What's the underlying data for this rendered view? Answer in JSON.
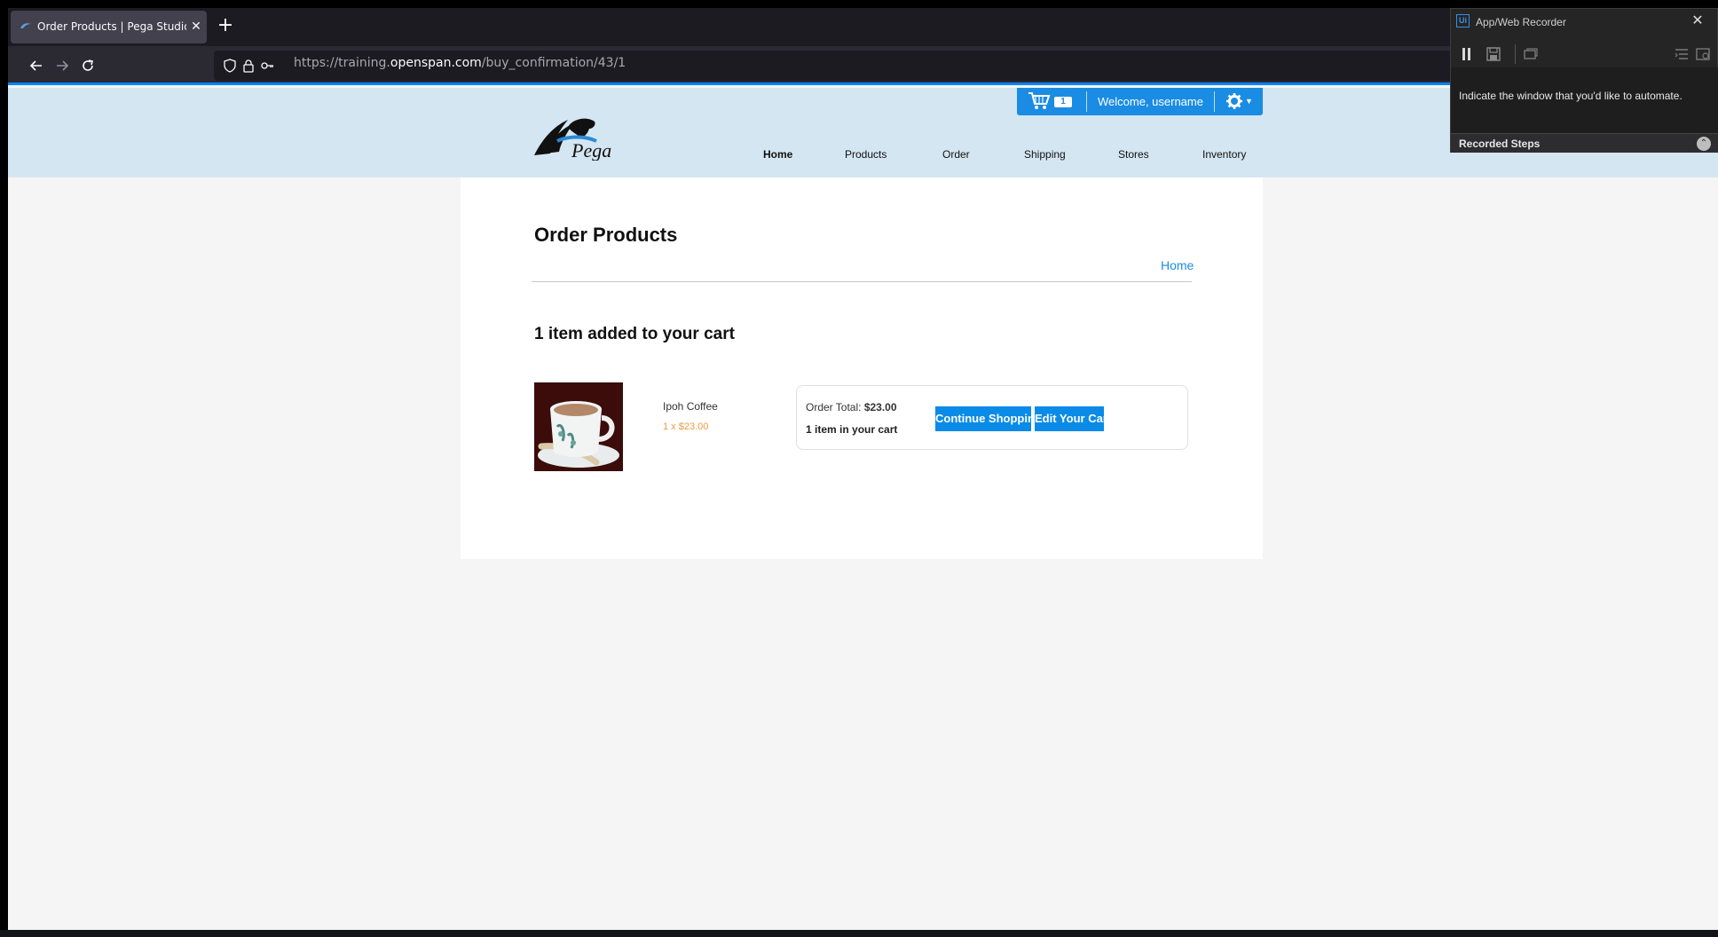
{
  "browser": {
    "tab_title": "Order Products | Pega Studio Tr",
    "tab_close": "✕",
    "new_tab": "+",
    "url_prefix": "https://training.",
    "url_host": "openspan.com",
    "url_path": "/buy_confirmation/43/1"
  },
  "header": {
    "cart_count": "1",
    "welcome": "Welcome, username",
    "gear_caret": "▼",
    "nav": [
      "Home",
      "Products",
      "Order",
      "Shipping",
      "Stores",
      "Inventory"
    ],
    "active_nav": "Home"
  },
  "main": {
    "page_title": "Order Products",
    "breadcrumb_home": "Home",
    "added_title": "1 item added to your cart",
    "product": {
      "name": "Ipoh Coffee",
      "qty_price": "1 x $23.00"
    },
    "summary": {
      "total_label": "Order Total: ",
      "total_value": "$23.00",
      "items_text": "1 item in your cart"
    },
    "buttons": {
      "continue": "Continue Shopping",
      "edit": "Edit Your Cart"
    }
  },
  "recorder": {
    "app_icon_text": "Ui",
    "title": "App/Web Recorder",
    "close": "✕",
    "instruction": "Indicate the window that you'd like to automate.",
    "steps_label": "Recorded Steps",
    "steps_toggle": "⌃"
  },
  "colors": {
    "accent": "#1b8ce3",
    "header_bg": "#d4e6f1",
    "price_orange": "#f19a3e"
  }
}
